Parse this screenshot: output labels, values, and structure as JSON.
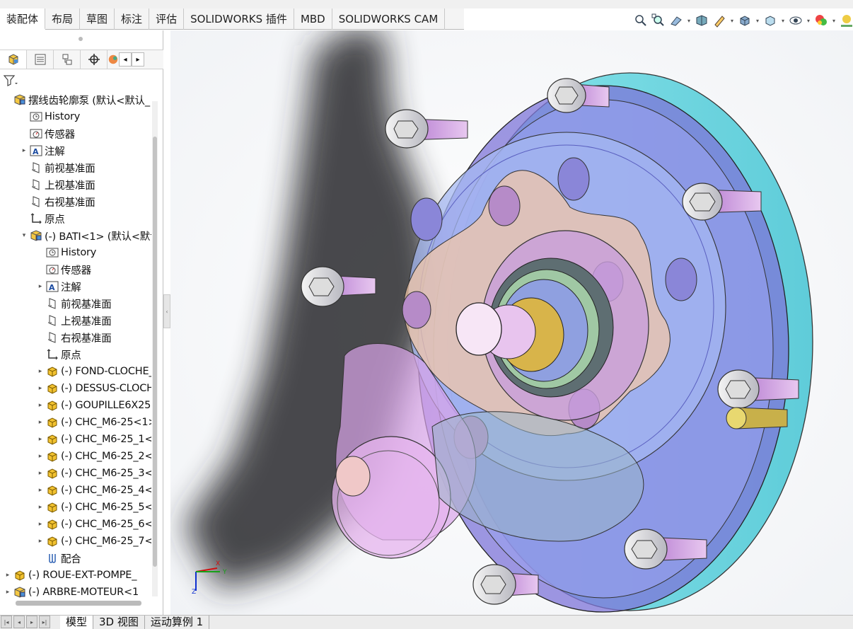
{
  "command_tabs": [
    {
      "label": "装配体",
      "active": true
    },
    {
      "label": "布局",
      "active": false
    },
    {
      "label": "草图",
      "active": false
    },
    {
      "label": "标注",
      "active": false
    },
    {
      "label": "评估",
      "active": false
    },
    {
      "label": "SOLIDWORKS 插件",
      "active": false
    },
    {
      "label": "MBD",
      "active": false
    },
    {
      "label": "SOLIDWORKS CAM",
      "active": false
    }
  ],
  "view_tools": [
    "zoom-to-fit-icon",
    "zoom-to-area-icon",
    "previous-view-icon",
    "section-view-icon",
    "dynamic-annotation-icon",
    "view-orientation-icon",
    "display-style-icon",
    "hide-show-icon",
    "edit-appearance-icon",
    "apply-scene-icon"
  ],
  "feature_tree": {
    "filter_icon": "filter-icon",
    "items": [
      {
        "label": "摆线齿轮廓泵 (默认<默认_",
        "icon": "assembly-icon",
        "expander": "",
        "level": 0
      },
      {
        "label": "History",
        "icon": "history-icon",
        "expander": "",
        "level": 1
      },
      {
        "label": "传感器",
        "icon": "sensor-icon",
        "expander": "",
        "level": 1
      },
      {
        "label": "注解",
        "icon": "annotation-icon",
        "expander": "▸",
        "level": 1
      },
      {
        "label": "前视基准面",
        "icon": "plane-icon",
        "expander": "",
        "level": 1
      },
      {
        "label": "上视基准面",
        "icon": "plane-icon",
        "expander": "",
        "level": 1
      },
      {
        "label": "右视基准面",
        "icon": "plane-icon",
        "expander": "",
        "level": 1
      },
      {
        "label": "原点",
        "icon": "origin-icon",
        "expander": "",
        "level": 1
      },
      {
        "label": "(-) BATI<1> (默认<默认",
        "icon": "subassembly-icon",
        "expander": "▾",
        "level": 1
      },
      {
        "label": "History",
        "icon": "history-icon",
        "expander": "",
        "level": 2
      },
      {
        "label": "传感器",
        "icon": "sensor-icon",
        "expander": "",
        "level": 2
      },
      {
        "label": "注解",
        "icon": "annotation-icon",
        "expander": "▸",
        "level": 2
      },
      {
        "label": "前视基准面",
        "icon": "plane-icon",
        "expander": "",
        "level": 2
      },
      {
        "label": "上视基准面",
        "icon": "plane-icon",
        "expander": "",
        "level": 2
      },
      {
        "label": "右视基准面",
        "icon": "plane-icon",
        "expander": "",
        "level": 2
      },
      {
        "label": "原点",
        "icon": "origin-icon",
        "expander": "",
        "level": 2
      },
      {
        "label": "(-) FOND-CLOCHE_",
        "icon": "part-icon",
        "expander": "▸",
        "level": 2
      },
      {
        "label": "(-) DESSUS-CLOCH",
        "icon": "part-icon",
        "expander": "▸",
        "level": 2
      },
      {
        "label": "(-) GOUPILLE6X25<",
        "icon": "part-icon",
        "expander": "▸",
        "level": 2
      },
      {
        "label": "(-) CHC_M6-25<1>",
        "icon": "part-icon",
        "expander": "▸",
        "level": 2
      },
      {
        "label": "(-) CHC_M6-25_1<",
        "icon": "part-icon",
        "expander": "▸",
        "level": 2
      },
      {
        "label": "(-) CHC_M6-25_2<",
        "icon": "part-icon",
        "expander": "▸",
        "level": 2
      },
      {
        "label": "(-) CHC_M6-25_3<",
        "icon": "part-icon",
        "expander": "▸",
        "level": 2
      },
      {
        "label": "(-) CHC_M6-25_4<",
        "icon": "part-icon",
        "expander": "▸",
        "level": 2
      },
      {
        "label": "(-) CHC_M6-25_5<",
        "icon": "part-icon",
        "expander": "▸",
        "level": 2
      },
      {
        "label": "(-) CHC_M6-25_6<",
        "icon": "part-icon",
        "expander": "▸",
        "level": 2
      },
      {
        "label": "(-) CHC_M6-25_7<",
        "icon": "part-icon",
        "expander": "▸",
        "level": 2
      },
      {
        "label": "配合",
        "icon": "mates-icon",
        "expander": "",
        "level": 2
      },
      {
        "label": "(-) ROUE-EXT-POMPE_",
        "icon": "part-icon",
        "expander": "▸",
        "level": 0
      },
      {
        "label": "(-) ARBRE-MOTEUR<1",
        "icon": "subassembly-icon",
        "expander": "▸",
        "level": 0
      }
    ]
  },
  "bottom_tabs": [
    {
      "label": "模型",
      "active": true
    },
    {
      "label": "3D 视图",
      "active": false
    },
    {
      "label": "运动算例 1",
      "active": false
    }
  ],
  "triad": {
    "x_label": "X",
    "y_label": "Y",
    "z_label": "Z"
  },
  "colors": {
    "x_axis": "#d01010",
    "y_axis": "#18a018",
    "z_axis": "#1030d0"
  }
}
